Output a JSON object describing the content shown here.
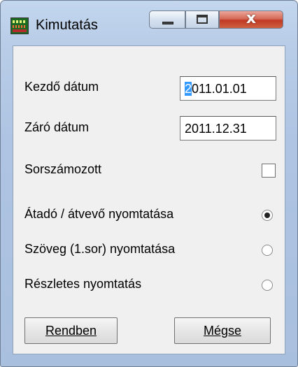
{
  "window": {
    "title": "Kimutatás",
    "close_glyph": "x"
  },
  "form": {
    "start_date_label": "Kezdő dátum",
    "start_date_first": "2",
    "start_date_rest": "011.01.01",
    "end_date_label": "Záró dátum",
    "end_date_value": "2011.12.31",
    "numbered_label": "Sorszámozott",
    "numbered_checked": false,
    "print_options": [
      {
        "label": "Átadó / átvevő nyomtatása",
        "selected": true
      },
      {
        "label": "Szöveg (1.sor) nyomtatása",
        "selected": false
      },
      {
        "label": "Részletes nyomtatás",
        "selected": false
      }
    ]
  },
  "buttons": {
    "ok_label": "Rendben",
    "cancel_label": "Mégse"
  },
  "colors": {
    "title_bar": "#b9cde8",
    "close_button": "#c8462c",
    "selection": "#3399ff"
  }
}
